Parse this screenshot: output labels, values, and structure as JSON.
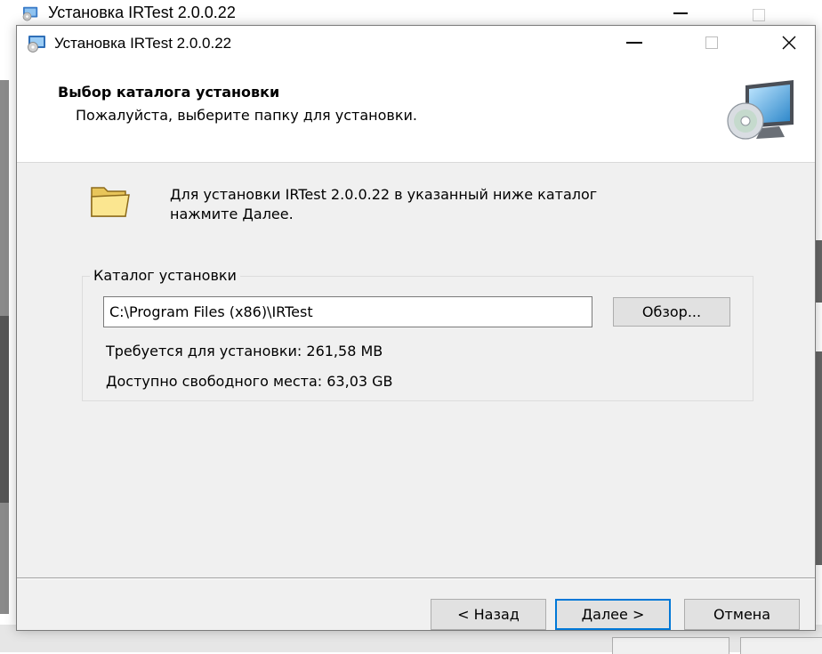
{
  "background_window": {
    "title": "Установка IRTest 2.0.0.22"
  },
  "window": {
    "title": "Установка IRTest 2.0.0.22",
    "controls": [
      "minimize",
      "maximize",
      "close"
    ]
  },
  "header": {
    "title": "Выбор каталога установки",
    "subtitle": "Пожалуйста, выберите папку для установки."
  },
  "intro": {
    "line1": "Для установки IRTest 2.0.0.22 в указанный ниже каталог",
    "line2": "нажмите Далее."
  },
  "install_dir_group": {
    "legend": "Каталог установки",
    "path_value": "C:\\Program Files (x86)\\IRTest",
    "browse_label": "Обзор...",
    "required_space": "Требуется для установки: 261,58 MB",
    "free_space": "Доступно свободного места: 63,03 GB"
  },
  "footer": {
    "back_label": "< Назад",
    "next_label": "Далее >",
    "cancel_label": "Отмена"
  },
  "icons": {
    "app": "installer-app-icon",
    "header": "monitor-cd-icon",
    "folder": "folder-icon",
    "close": "close-icon"
  },
  "colors": {
    "dialog_bg": "#f0f0f0",
    "header_bg": "#ffffff",
    "focus_border": "#0078d7",
    "button_bg": "#e1e1e1"
  }
}
